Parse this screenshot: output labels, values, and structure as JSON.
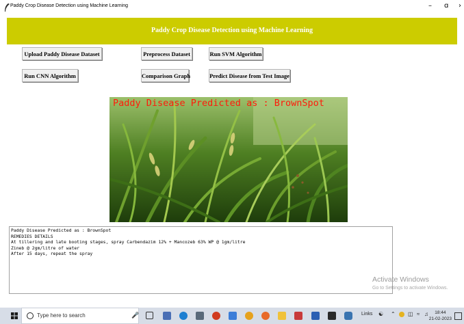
{
  "window": {
    "title": "Paddy Crop Disease Detection using Machine Learning",
    "controls": {
      "minimize": "–",
      "maximize": "ɑ",
      "close": "›"
    }
  },
  "banner": {
    "title": "Paddy Crop Disease Detection using Machine Learning",
    "color": "#cccc00"
  },
  "buttons": {
    "upload": "Upload Paddy Disease Dataset",
    "preprocess": "Preprocess Dataset",
    "svm": "Run SVM Algorithm",
    "cnn": "Run CNN Algorithm",
    "comparison": "Comparison Graph",
    "predict": "Predict Disease from Test Image"
  },
  "image": {
    "overlay_text": "Paddy Disease Predicted as : BrownSpot",
    "overlay_color": "#ff1a0a"
  },
  "output": {
    "lines": [
      "Paddy Disease Predicted as : BrownSpot",
      "REMEDIES DETAILS",
      "At tillering and late booting stages, spray Carbendazim 12% + Mancozeb 63% WP @ 1gm/litre",
      "Zineb @ 2gm/litre of water",
      "After 15 days, repeat the spray"
    ]
  },
  "watermark": {
    "line1": "Activate Windows",
    "line2": "Go to Settings to activate Windows."
  },
  "taskbar": {
    "search_placeholder": "Type here to search",
    "links_label": "Links",
    "time": "18:44",
    "date": "21-02-2023",
    "icons": [
      "task-view-icon",
      "notes-icon",
      "edge-icon",
      "store-icon",
      "office-icon",
      "media-icon",
      "chrome-icon",
      "firefox-icon",
      "files-icon",
      "paint-icon",
      "word-icon",
      "terminal-icon",
      "python-icon"
    ]
  }
}
